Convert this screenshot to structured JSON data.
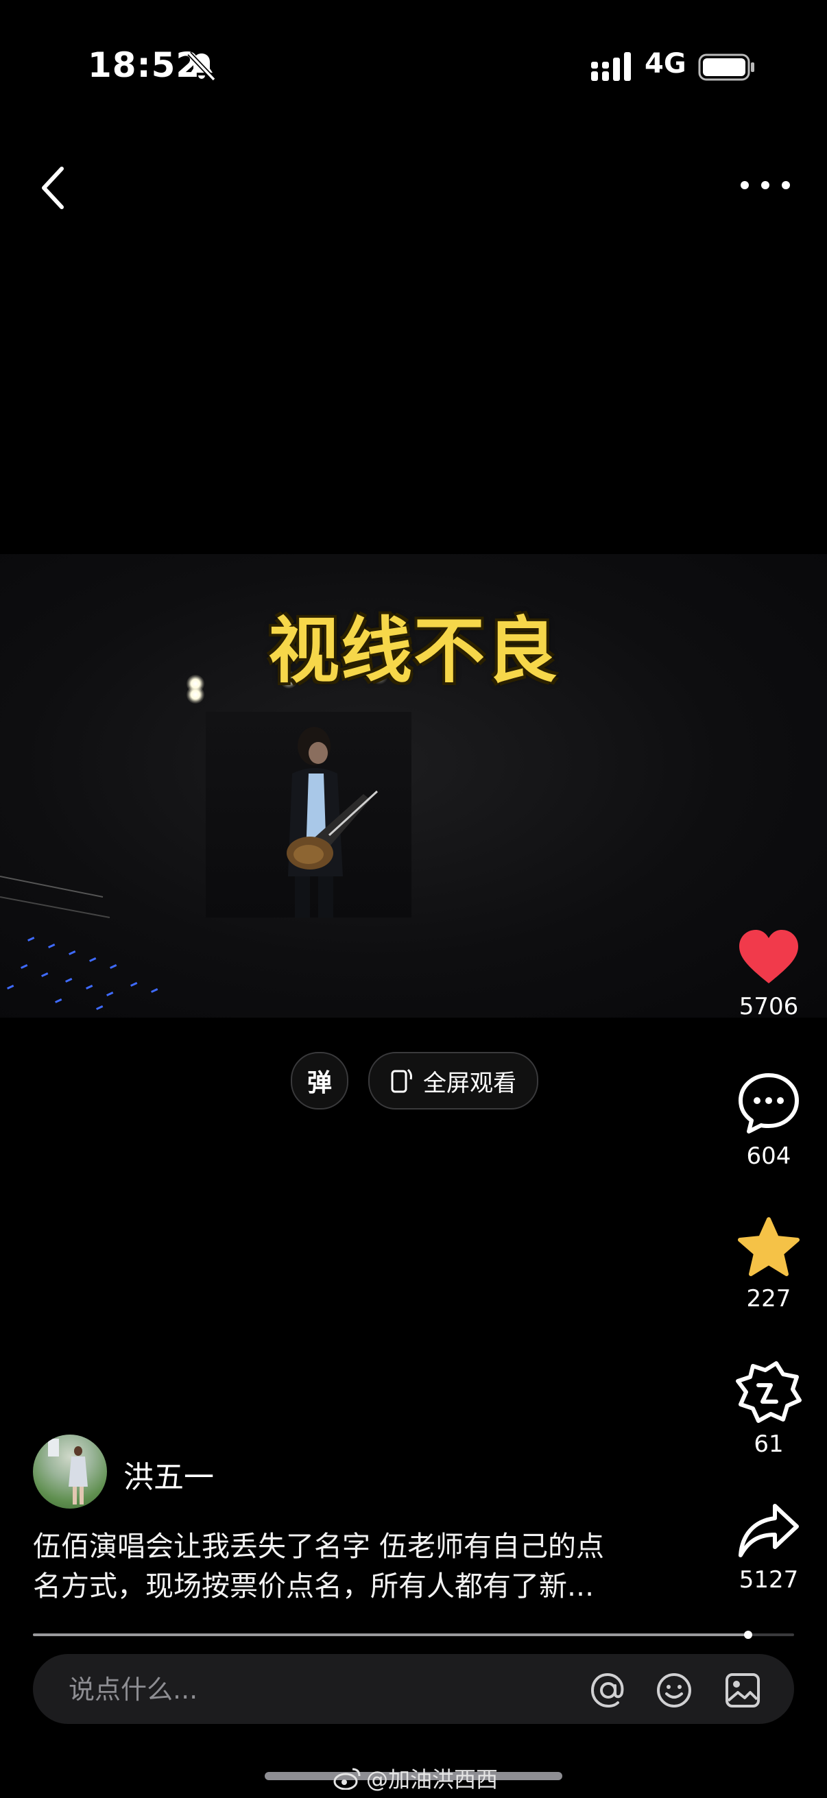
{
  "status_bar": {
    "time": "18:52",
    "network": "4G",
    "icons": [
      "bell-slash-icon",
      "signal-icon",
      "battery-icon"
    ]
  },
  "nav": {
    "icons": [
      "chevron-left-icon",
      "more-dots-icon"
    ]
  },
  "video": {
    "subtitle": "视线不良"
  },
  "controls": {
    "danmaku_label": "弹",
    "fullscreen_label": "全屏观看"
  },
  "actions": {
    "like": {
      "count": "5706",
      "icon": "heart-icon",
      "color": "#f13a4b"
    },
    "comment": {
      "count": "604",
      "icon": "comment-bubble-icon"
    },
    "favorite": {
      "count": "227",
      "icon": "star-icon",
      "color": "#f5c247"
    },
    "repost": {
      "count": "61",
      "icon": "repost-badge-icon"
    },
    "share": {
      "count": "5127",
      "icon": "share-arrow-icon"
    }
  },
  "author": {
    "name": "洪五一"
  },
  "caption": {
    "line1": "伍佰演唱会让我丢失了名字 伍老师有自己的点",
    "line2": "名方式，现场按票价点名，所有人都有了新..."
  },
  "progress": {
    "fraction": 0.94
  },
  "comment_bar": {
    "placeholder": "说点什么...",
    "icons": [
      "at-icon",
      "emoji-icon",
      "image-icon"
    ]
  },
  "watermark": {
    "text": "@加油洪西西"
  }
}
